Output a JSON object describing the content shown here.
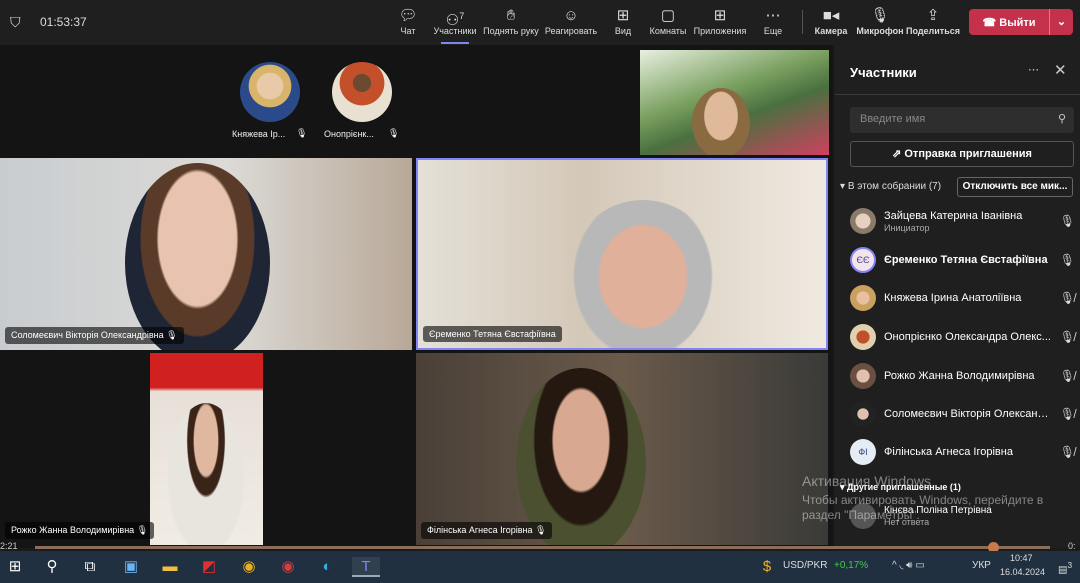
{
  "topbar": {
    "timer": "01:53:37",
    "participants_count": "7",
    "buttons": [
      {
        "label": "Чат",
        "icon": "chat-icon"
      },
      {
        "label": "Участники",
        "icon": "people-icon"
      },
      {
        "label": "Поднять руку",
        "icon": "hand-icon"
      },
      {
        "label": "Реагировать",
        "icon": "smile-icon"
      },
      {
        "label": "Вид",
        "icon": "grid-icon"
      },
      {
        "label": "Комнаты",
        "icon": "rooms-icon"
      },
      {
        "label": "Приложения",
        "icon": "plus-icon"
      },
      {
        "label": "Еще",
        "icon": "more-icon"
      },
      {
        "label": "Камера",
        "icon": "camera-icon"
      },
      {
        "label": "Микрофон",
        "icon": "mic-icon"
      },
      {
        "label": "Поделиться",
        "icon": "share-icon"
      }
    ],
    "leave_label": "Выйти"
  },
  "stage": {
    "top_avatars": [
      {
        "label": "Княжева Ір..."
      },
      {
        "label": "Онопрієнк..."
      }
    ],
    "tiles": [
      "Соломеєвич Вікторія Олександрівна",
      "Єременко Тетяна Євстафіївна",
      "Рожко Жанна Володимирівна",
      "Філінська Агнеса Ігорівна"
    ]
  },
  "panel": {
    "title": "Участники",
    "search_placeholder": "Введите имя",
    "invite_label": "Отправка приглашения",
    "section_label": "В этом собрании (7)",
    "mute_all_label": "Отключить все мик...",
    "participants": [
      {
        "name": "Зайцева Катерина Іванівна",
        "role": "Инициатор",
        "mic": "on"
      },
      {
        "name": "Єременко Тетяна Євстафіївна",
        "initials": "ЄЄ",
        "mic": "on"
      },
      {
        "name": "Княжева Ірина Анатоліївна",
        "mic": "off"
      },
      {
        "name": "Онопрієнко Олександра Олекс...",
        "mic": "off"
      },
      {
        "name": "Рожко Жанна Володимирівна",
        "mic": "off"
      },
      {
        "name": "Соломеєвич Вікторія Олександ...",
        "mic": "off"
      },
      {
        "name": "Філінська Агнеса Ігорівна",
        "initials": "ФІ",
        "mic": "off"
      }
    ],
    "others_label": "Другие приглашенные (1)",
    "others": [
      {
        "name": "Кінєва Поліна Петрівна",
        "status": "Нет ответа"
      }
    ]
  },
  "watermark": {
    "title": "Активация Windows",
    "line1": "Чтобы активировать Windows, перейдите в",
    "line2": "раздел \"Параметры\"."
  },
  "player": {
    "elapsed": "2:21",
    "end": "0:"
  },
  "taskbar": {
    "ticker": "USD/PKR",
    "change": "+0,17%",
    "lang": "УКР",
    "time": "10:47",
    "date": "16.04.2024",
    "notifications": "3"
  }
}
